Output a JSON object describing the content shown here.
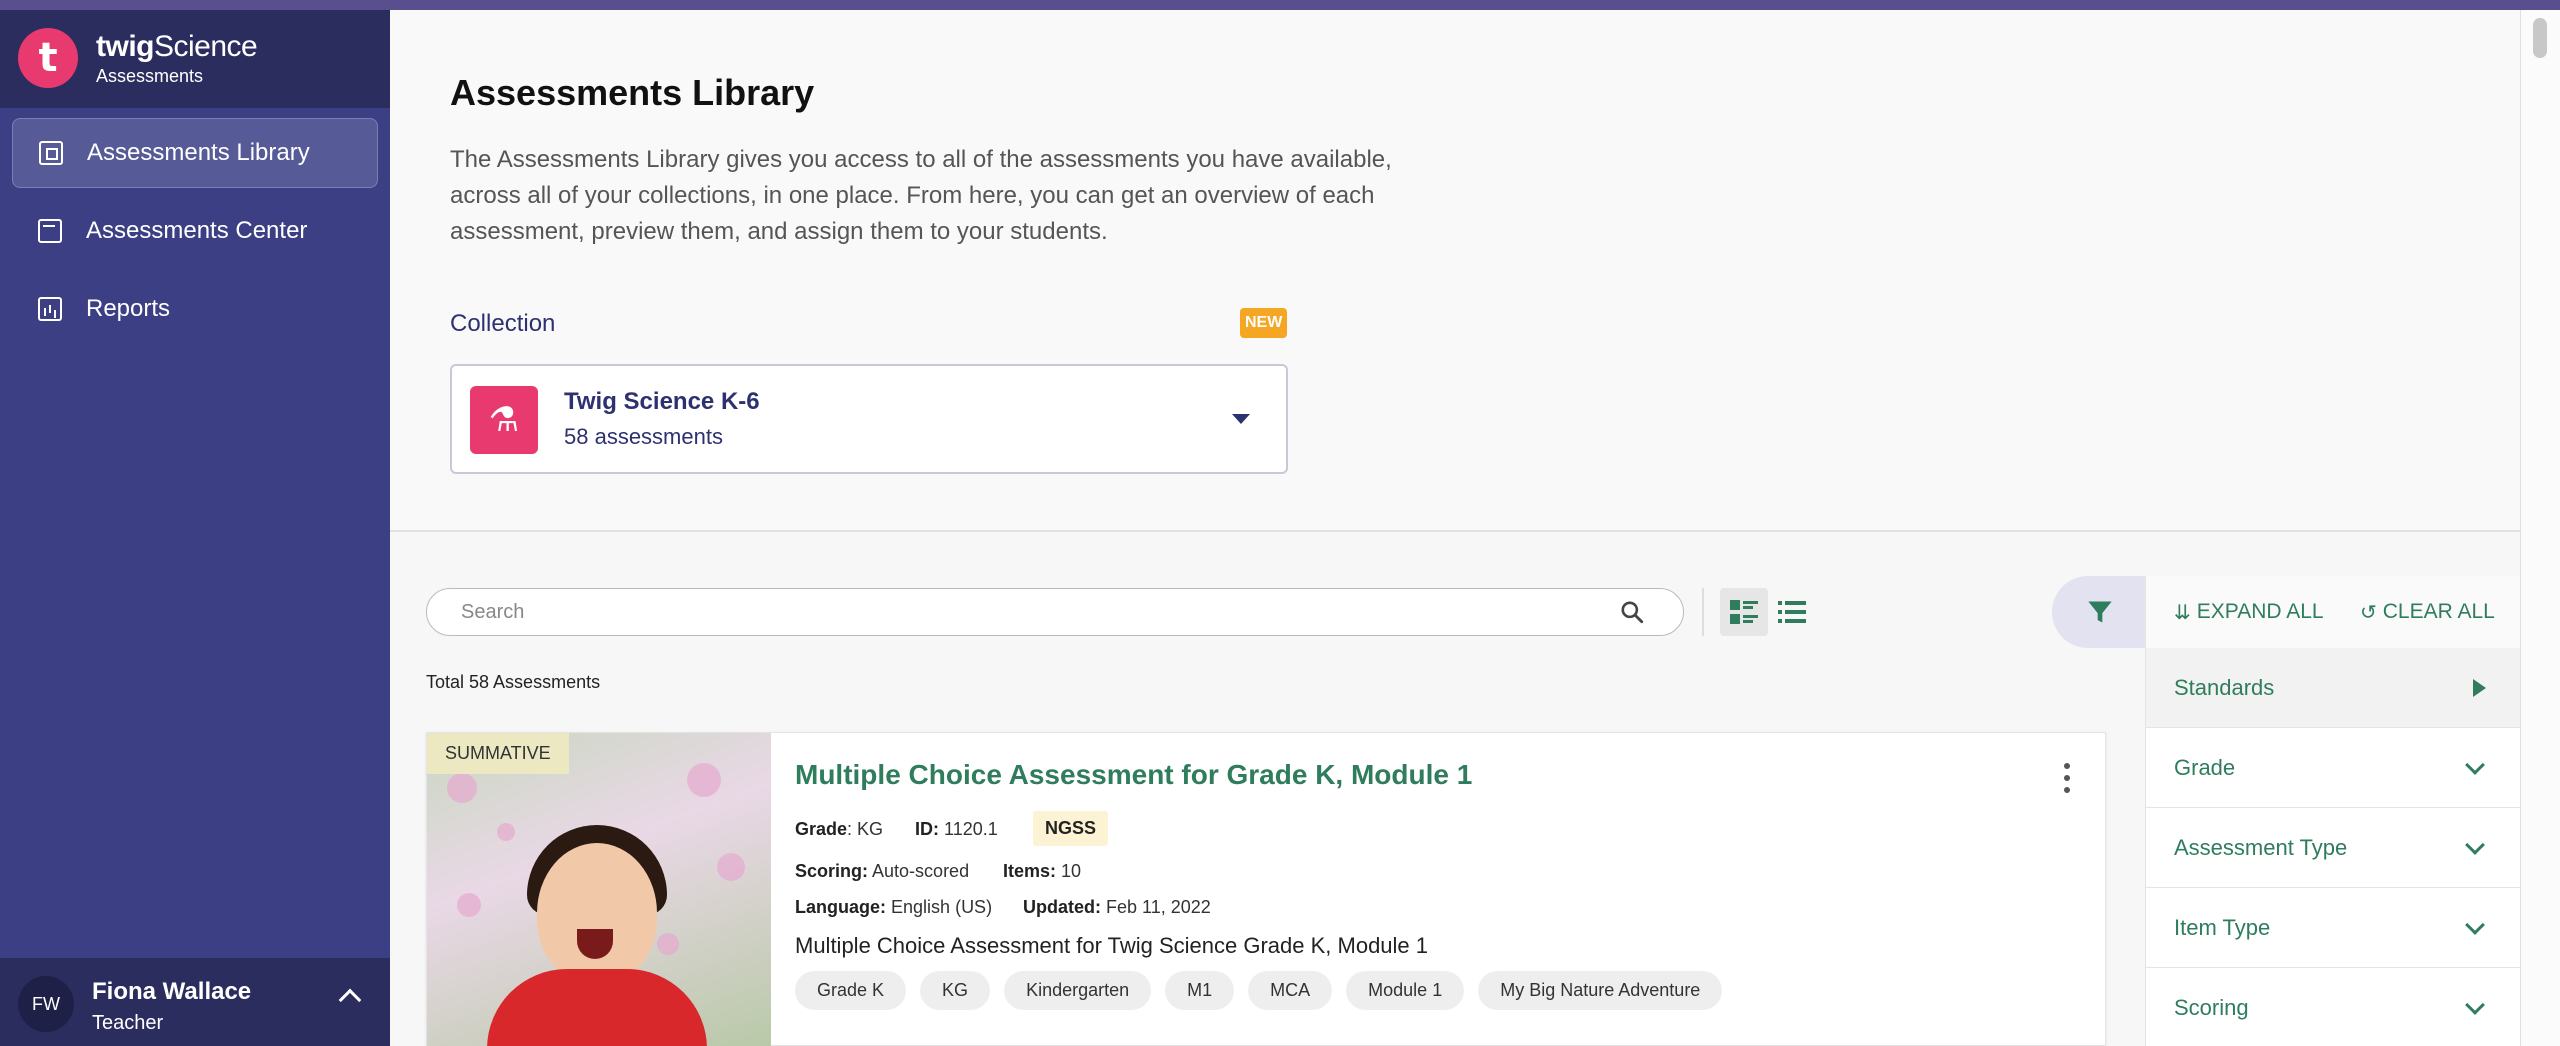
{
  "brand": {
    "logo_letter": "t",
    "name_bold": "twig",
    "name_regular": "Science",
    "subtitle": "Assessments"
  },
  "sidebar": {
    "items": [
      {
        "label": "Assessments Library",
        "active": true
      },
      {
        "label": "Assessments Center",
        "active": false
      },
      {
        "label": "Reports",
        "active": false
      }
    ]
  },
  "user": {
    "initials": "FW",
    "name": "Fiona Wallace",
    "role": "Teacher"
  },
  "header": {
    "title": "Assessments Library",
    "description": "The Assessments Library gives you access to all of the assessments you have available, across all of your collections, in one place. From here, you can get an overview of each assessment, preview them, and assign them to your students.",
    "collection_label": "Collection",
    "new_badge": "NEW",
    "collection": {
      "name": "Twig Science K-6",
      "count": "58 assessments"
    }
  },
  "toolbar": {
    "search_placeholder": "Search",
    "total": "Total 58 Assessments"
  },
  "filters": {
    "expand_all": "EXPAND ALL",
    "clear_all": "CLEAR ALL",
    "items": [
      "Standards",
      "Grade",
      "Assessment Type",
      "Item Type",
      "Scoring"
    ]
  },
  "card": {
    "type_badge": "SUMMATIVE",
    "title": "Multiple Choice Assessment for Grade K, Module 1",
    "grade_label": "Grade",
    "grade": "KG",
    "id_label": "ID:",
    "id": "1120.1",
    "standard_badge": "NGSS",
    "scoring_label": "Scoring:",
    "scoring": "Auto-scored",
    "items_label": "Items:",
    "items": "10",
    "language_label": "Language:",
    "language": "English (US)",
    "updated_label": "Updated:",
    "updated": "Feb 11, 2022",
    "description": "Multiple Choice Assessment for Twig Science Grade K, Module 1",
    "tags": [
      "Grade K",
      "KG",
      "Kindergarten",
      "M1",
      "MCA",
      "Module 1",
      "My Big Nature Adventure"
    ]
  },
  "colors": {
    "sidebar": "#3c3f83",
    "accent_pink": "#e93a6f",
    "green": "#2f7d5c",
    "navy_text": "#2e3170"
  }
}
